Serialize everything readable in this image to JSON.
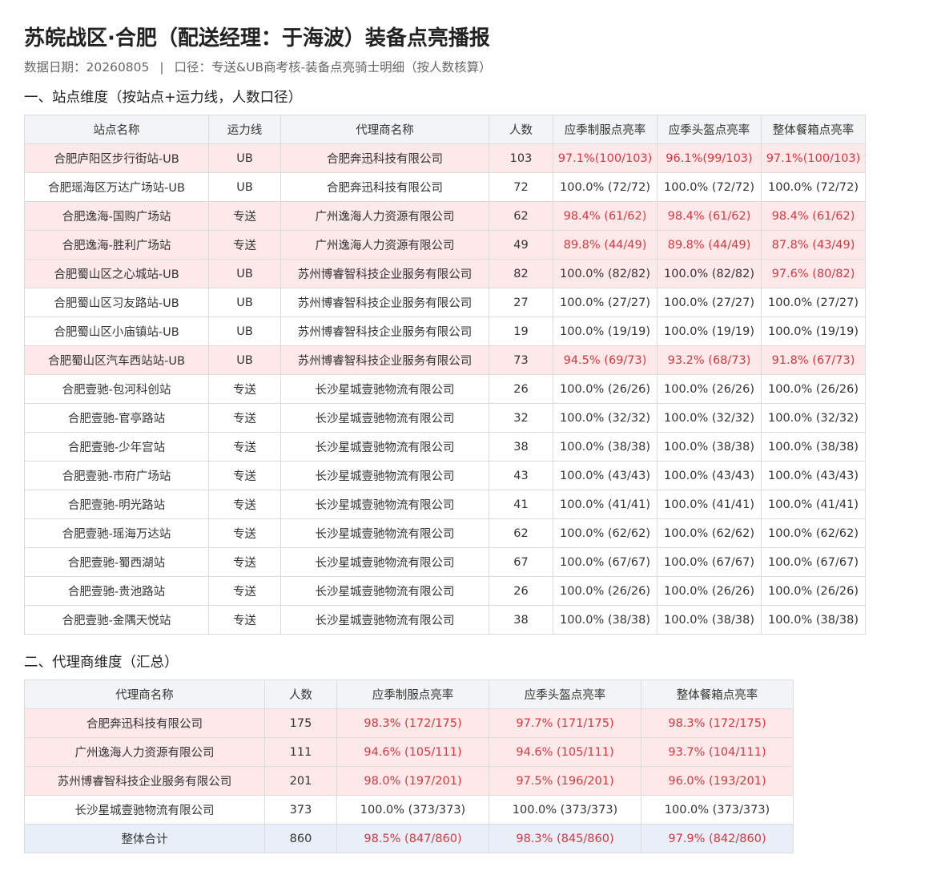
{
  "header": {
    "title": "苏皖战区·合肥（配送经理：于海波）装备点亮播报",
    "date_text": "数据日期：20260805",
    "separator": "|",
    "scope_text": "口径：专送&UB商考核-装备点亮骑士明细（按人数核算）"
  },
  "station_section": {
    "title": "一、站点维度（按站点+运力线，人数口径）",
    "columns": [
      "站点名称",
      "运力线",
      "代理商名称",
      "人数",
      "应季制服点亮率",
      "应季头盔点亮率",
      "整体餐箱点亮率"
    ],
    "rows": [
      {
        "cells": [
          "合肥庐阳区步行街站-UB",
          "UB",
          "合肥奔迅科技有限公司",
          "103",
          "97.1%(100/103)",
          "96.1%(99/103)",
          "97.1%(100/103)"
        ],
        "highlight": true,
        "bad": [
          4,
          5,
          6
        ]
      },
      {
        "cells": [
          "合肥瑶海区万达广场站-UB",
          "UB",
          "合肥奔迅科技有限公司",
          "72",
          "100.0% (72/72)",
          "100.0% (72/72)",
          "100.0% (72/72)"
        ],
        "highlight": false,
        "bad": []
      },
      {
        "cells": [
          "合肥逸海-国购广场站",
          "专送",
          "广州逸海人力资源有限公司",
          "62",
          "98.4% (61/62)",
          "98.4% (61/62)",
          "98.4% (61/62)"
        ],
        "highlight": true,
        "bad": [
          4,
          5,
          6
        ]
      },
      {
        "cells": [
          "合肥逸海-胜利广场站",
          "专送",
          "广州逸海人力资源有限公司",
          "49",
          "89.8% (44/49)",
          "89.8% (44/49)",
          "87.8% (43/49)"
        ],
        "highlight": true,
        "bad": [
          4,
          5,
          6
        ]
      },
      {
        "cells": [
          "合肥蜀山区之心城站-UB",
          "UB",
          "苏州博睿智科技企业服务有限公司",
          "82",
          "100.0% (82/82)",
          "100.0% (82/82)",
          "97.6% (80/82)"
        ],
        "highlight": true,
        "bad": [
          6
        ]
      },
      {
        "cells": [
          "合肥蜀山区习友路站-UB",
          "UB",
          "苏州博睿智科技企业服务有限公司",
          "27",
          "100.0% (27/27)",
          "100.0% (27/27)",
          "100.0% (27/27)"
        ],
        "highlight": false,
        "bad": []
      },
      {
        "cells": [
          "合肥蜀山区小庙镇站-UB",
          "UB",
          "苏州博睿智科技企业服务有限公司",
          "19",
          "100.0% (19/19)",
          "100.0% (19/19)",
          "100.0% (19/19)"
        ],
        "highlight": false,
        "bad": []
      },
      {
        "cells": [
          "合肥蜀山区汽车西站站-UB",
          "UB",
          "苏州博睿智科技企业服务有限公司",
          "73",
          "94.5% (69/73)",
          "93.2% (68/73)",
          "91.8% (67/73)"
        ],
        "highlight": true,
        "bad": [
          4,
          5,
          6
        ]
      },
      {
        "cells": [
          "合肥壹驰-包河科创站",
          "专送",
          "长沙星城壹驰物流有限公司",
          "26",
          "100.0% (26/26)",
          "100.0% (26/26)",
          "100.0% (26/26)"
        ],
        "highlight": false,
        "bad": []
      },
      {
        "cells": [
          "合肥壹驰-官亭路站",
          "专送",
          "长沙星城壹驰物流有限公司",
          "32",
          "100.0% (32/32)",
          "100.0% (32/32)",
          "100.0% (32/32)"
        ],
        "highlight": false,
        "bad": []
      },
      {
        "cells": [
          "合肥壹驰-少年宫站",
          "专送",
          "长沙星城壹驰物流有限公司",
          "38",
          "100.0% (38/38)",
          "100.0% (38/38)",
          "100.0% (38/38)"
        ],
        "highlight": false,
        "bad": []
      },
      {
        "cells": [
          "合肥壹驰-市府广场站",
          "专送",
          "长沙星城壹驰物流有限公司",
          "43",
          "100.0% (43/43)",
          "100.0% (43/43)",
          "100.0% (43/43)"
        ],
        "highlight": false,
        "bad": []
      },
      {
        "cells": [
          "合肥壹驰-明光路站",
          "专送",
          "长沙星城壹驰物流有限公司",
          "41",
          "100.0% (41/41)",
          "100.0% (41/41)",
          "100.0% (41/41)"
        ],
        "highlight": false,
        "bad": []
      },
      {
        "cells": [
          "合肥壹驰-瑶海万达站",
          "专送",
          "长沙星城壹驰物流有限公司",
          "62",
          "100.0% (62/62)",
          "100.0% (62/62)",
          "100.0% (62/62)"
        ],
        "highlight": false,
        "bad": []
      },
      {
        "cells": [
          "合肥壹驰-蜀西湖站",
          "专送",
          "长沙星城壹驰物流有限公司",
          "67",
          "100.0% (67/67)",
          "100.0% (67/67)",
          "100.0% (67/67)"
        ],
        "highlight": false,
        "bad": []
      },
      {
        "cells": [
          "合肥壹驰-贵池路站",
          "专送",
          "长沙星城壹驰物流有限公司",
          "26",
          "100.0% (26/26)",
          "100.0% (26/26)",
          "100.0% (26/26)"
        ],
        "highlight": false,
        "bad": []
      },
      {
        "cells": [
          "合肥壹驰-金隅天悦站",
          "专送",
          "长沙星城壹驰物流有限公司",
          "38",
          "100.0% (38/38)",
          "100.0% (38/38)",
          "100.0% (38/38)"
        ],
        "highlight": false,
        "bad": []
      }
    ]
  },
  "agent_section": {
    "title": "二、代理商维度（汇总）",
    "columns": [
      "代理商名称",
      "人数",
      "应季制服点亮率",
      "应季头盔点亮率",
      "整体餐箱点亮率"
    ],
    "rows": [
      {
        "cells": [
          "合肥奔迅科技有限公司",
          "175",
          "98.3% (172/175)",
          "97.7% (171/175)",
          "98.3% (172/175)"
        ],
        "highlight": true,
        "bad": [
          2,
          3,
          4
        ]
      },
      {
        "cells": [
          "广州逸海人力资源有限公司",
          "111",
          "94.6% (105/111)",
          "94.6% (105/111)",
          "93.7% (104/111)"
        ],
        "highlight": true,
        "bad": [
          2,
          3,
          4
        ]
      },
      {
        "cells": [
          "苏州博睿智科技企业服务有限公司",
          "201",
          "98.0% (197/201)",
          "97.5% (196/201)",
          "96.0% (193/201)"
        ],
        "highlight": true,
        "bad": [
          2,
          3,
          4
        ]
      },
      {
        "cells": [
          "长沙星城壹驰物流有限公司",
          "373",
          "100.0% (373/373)",
          "100.0% (373/373)",
          "100.0% (373/373)"
        ],
        "highlight": false,
        "bad": []
      }
    ],
    "total": {
      "cells": [
        "整体合计",
        "860",
        "98.5% (847/860)",
        "98.3% (845/860)",
        "97.9% (842/860)"
      ],
      "bad": [
        2,
        3,
        4
      ]
    }
  },
  "colors": {
    "alert_text": "#d9363e",
    "alert_row_bg": "#fde9ea",
    "total_row_bg": "#e8eff8",
    "header_bg": "#f3f4f6",
    "border": "#dcdcdc"
  }
}
